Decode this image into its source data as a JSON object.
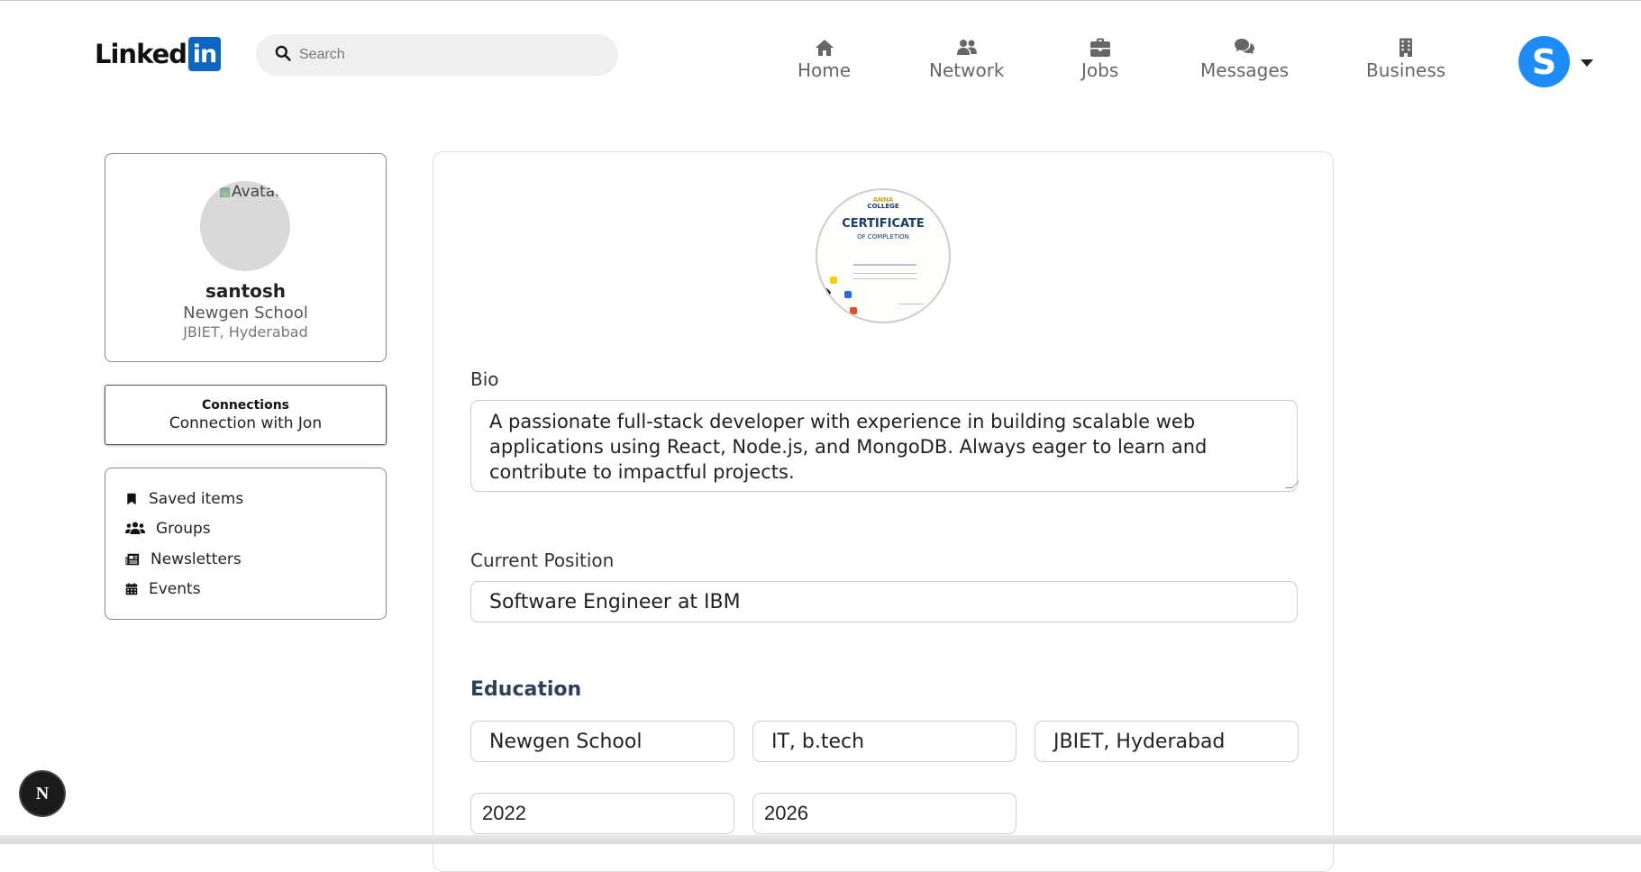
{
  "header": {
    "logo_text": "Linked",
    "logo_box": "in",
    "search_placeholder": "Search",
    "nav": [
      {
        "label": "Home",
        "icon": "home-icon"
      },
      {
        "label": "Network",
        "icon": "users-icon"
      },
      {
        "label": "Jobs",
        "icon": "briefcase-icon"
      },
      {
        "label": "Messages",
        "icon": "comments-icon"
      },
      {
        "label": "Business",
        "icon": "building-icon"
      }
    ],
    "avatar_letter": "S"
  },
  "profile": {
    "avatar_alt": "Avatar",
    "name": "santosh",
    "school": "Newgen School",
    "location": "JBIET, Hyderabad"
  },
  "connections": {
    "title": "Connections",
    "subtitle": "Connection with Jon"
  },
  "links": [
    {
      "label": "Saved items",
      "icon": "bookmark-icon"
    },
    {
      "label": "Groups",
      "icon": "groups-icon"
    },
    {
      "label": "Newsletters",
      "icon": "newspaper-icon"
    },
    {
      "label": "Events",
      "icon": "calendar-icon"
    }
  ],
  "certificate": {
    "org": "ANNA",
    "org2": "COLLEGE",
    "title": "CERTIFICATE",
    "subtitle": "OF COMPLETION"
  },
  "form": {
    "bio_label": "Bio",
    "bio": "A passionate full-stack developer with experience in building scalable web applications using React, Node.js, and MongoDB. Always eager to learn and contribute to impactful projects.",
    "position_label": "Current Position",
    "position": "Software Engineer at IBM",
    "education_title": "Education",
    "education": {
      "school": "Newgen School",
      "degree": "IT,  b.tech",
      "location": "JBIET, Hyderabad",
      "start_year": "2022",
      "end_year": "2026"
    }
  },
  "badge": "N",
  "colors": {
    "brand": "#0a66c2",
    "avatar": "#1d8cf8",
    "section_title": "#2e4057"
  }
}
